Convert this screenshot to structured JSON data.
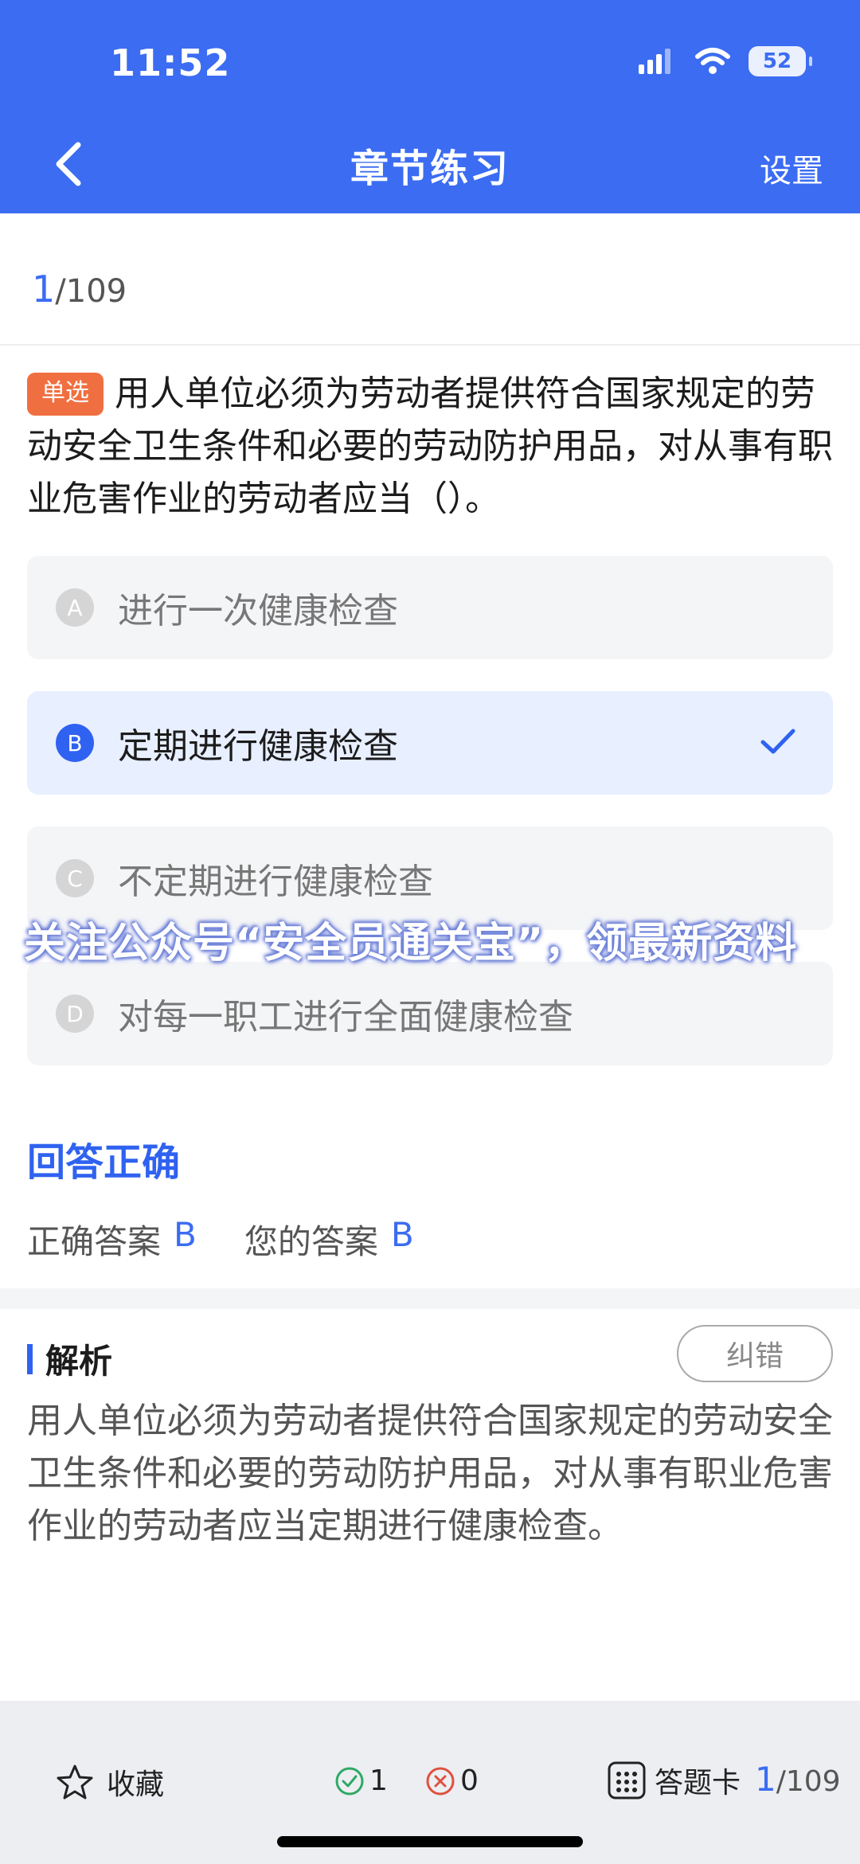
{
  "status_bar": {
    "time": "11:52",
    "battery": "52"
  },
  "nav": {
    "title": "章节练习",
    "action": "设置"
  },
  "progress": {
    "current": "1",
    "total": "/109"
  },
  "question": {
    "type_tag": "单选",
    "text": "用人单位必须为劳动者提供符合国家规定的劳动安全卫生条件和必要的劳动防护用品，对从事有职业危害作业的劳动者应当（）。"
  },
  "options": [
    {
      "letter": "A",
      "text": "进行一次健康检查",
      "selected": false
    },
    {
      "letter": "B",
      "text": "定期进行健康检查",
      "selected": true
    },
    {
      "letter": "C",
      "text": "不定期进行健康检查",
      "selected": false
    },
    {
      "letter": "D",
      "text": "对每一职工进行全面健康检查",
      "selected": false
    }
  ],
  "watermark": "关注公众号“安全员通关宝”，领最新资料",
  "result": {
    "title": "回答正确",
    "correct_label": "正确答案",
    "correct_value": "B",
    "yours_label": "您的答案",
    "yours_value": "B"
  },
  "analysis": {
    "title": "解析",
    "report_button": "纠错",
    "text": "用人单位必须为劳动者提供符合国家规定的劳动安全卫生条件和必要的劳动防护用品，对从事有职业危害作业的劳动者应当定期进行健康检查。"
  },
  "bottom_bar": {
    "favorite_label": "收藏",
    "correct_count": "1",
    "wrong_count": "0",
    "answer_card_label": "答题卡",
    "progress_current": "1",
    "progress_total": "/109"
  },
  "colors": {
    "primary": "#3b6cf2",
    "tag": "#f06f41",
    "correct_icon": "#2fa866",
    "wrong_icon": "#e0503f"
  },
  "icons": [
    "back-chevron-icon",
    "signal-icon",
    "wifi-icon",
    "battery-icon",
    "checkmark-icon",
    "star-icon",
    "check-circle-icon",
    "x-circle-icon",
    "grid-icon"
  ]
}
